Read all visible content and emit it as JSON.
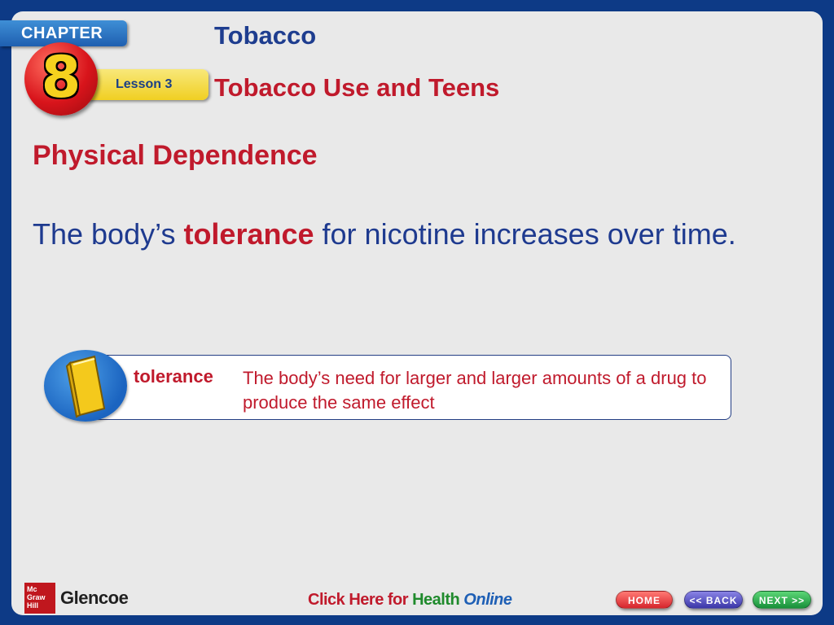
{
  "header": {
    "chapter_label": "CHAPTER",
    "chapter_number": "8",
    "lesson_label": "Lesson 3",
    "title": "Tobacco",
    "subtitle": "Tobacco Use and Teens"
  },
  "content": {
    "section_heading": "Physical Dependence",
    "body_before": "The body’s ",
    "body_keyword": "tolerance",
    "body_after": " for nicotine increases over time."
  },
  "vocabulary": {
    "icon": "book-icon",
    "term": "tolerance",
    "definition": "The body’s need for larger and larger amounts of a drug to produce the same effect"
  },
  "footer": {
    "publisher_logo": "Mc Graw Hill",
    "publisher_name": "Glencoe",
    "online_part1": "Click Here for ",
    "online_part2": "Health",
    "online_part3": " Online",
    "home_label": "HOME",
    "back_label": "<< BACK",
    "next_label": "NEXT >>"
  },
  "colors": {
    "frame": "#0d3a86",
    "heading_red": "#c01a2c",
    "body_blue": "#1e3a8f"
  }
}
